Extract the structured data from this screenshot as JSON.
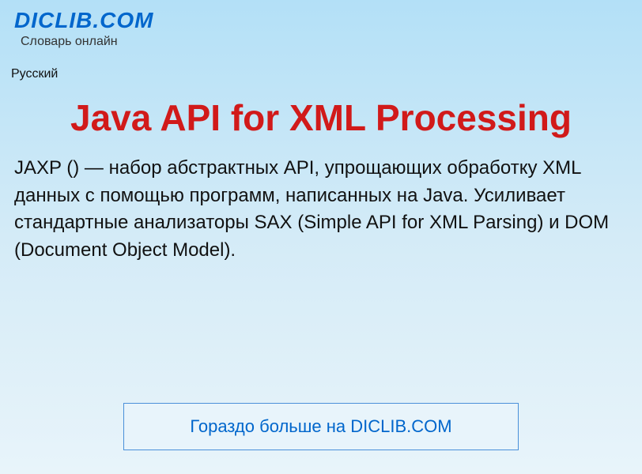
{
  "header": {
    "site_title": "DICLIB.COM",
    "site_subtitle": "Словарь онлайн"
  },
  "language": "Русский",
  "main_title": "Java API for XML Processing",
  "body_text": "JAXP () — набор абстрактных API, упрощающих обработку XML данных с помощью программ, написанных на Java. Усиливает стандартные анализаторы SAX (Simple API for XML Parsing) и DOM (Document Object Model).",
  "cta": {
    "label": "Гораздо больше на DICLIB.COM"
  }
}
